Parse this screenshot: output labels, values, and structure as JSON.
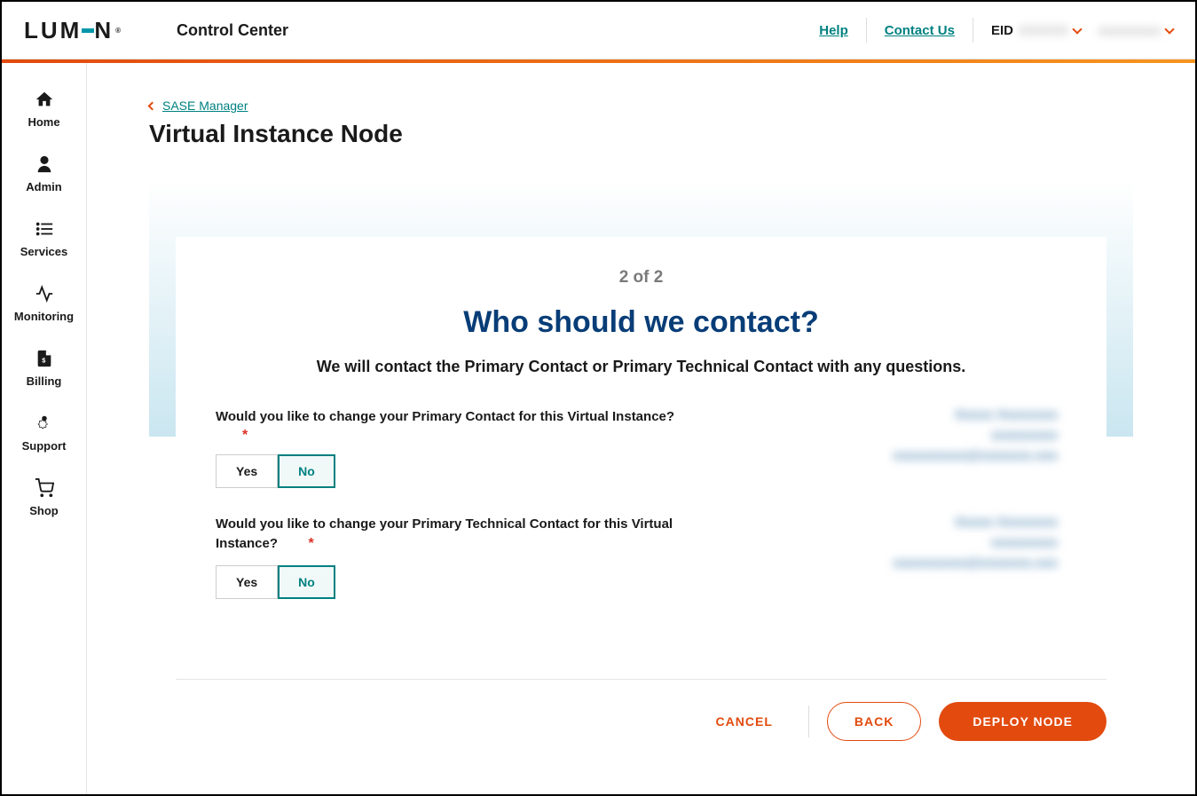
{
  "header": {
    "logo_text": "LUMEN",
    "app_name": "Control Center",
    "help_link": "Help",
    "contact_link": "Contact Us",
    "eid_label": "EID",
    "eid_value": "XXXXXX",
    "username": "xxxxxxxxxx"
  },
  "sidebar": {
    "items": [
      {
        "label": "Home",
        "icon": "home"
      },
      {
        "label": "Admin",
        "icon": "person"
      },
      {
        "label": "Services",
        "icon": "list"
      },
      {
        "label": "Monitoring",
        "icon": "activity"
      },
      {
        "label": "Billing",
        "icon": "invoice"
      },
      {
        "label": "Support",
        "icon": "gear-person"
      },
      {
        "label": "Shop",
        "icon": "cart"
      }
    ]
  },
  "breadcrumb": {
    "back_label": "SASE Manager"
  },
  "page": {
    "title": "Virtual Instance Node",
    "step_indicator": "2 of 2",
    "card_title": "Who should we contact?",
    "card_subtitle": "We will contact the Primary Contact or Primary Technical Contact with any questions.",
    "question1": "Would you like to change your Primary Contact for this Virtual Instance?",
    "question2": "Would you like to change your Primary Technical Contact for this Virtual Instance?",
    "yes_label": "Yes",
    "no_label": "No",
    "contact1": {
      "name": "Xxxxx Xxxxxxxx",
      "detail": "xxxxxxxxx",
      "email": "xxxxxxxxxx@xxxxxxx.xxx"
    },
    "contact2": {
      "name": "Xxxxx Xxxxxxxx",
      "detail": "xxxxxxxxx",
      "email": "xxxxxxxxxx@xxxxxxx.xxx"
    }
  },
  "actions": {
    "cancel": "CANCEL",
    "back": "BACK",
    "deploy": "DEPLOY NODE"
  }
}
